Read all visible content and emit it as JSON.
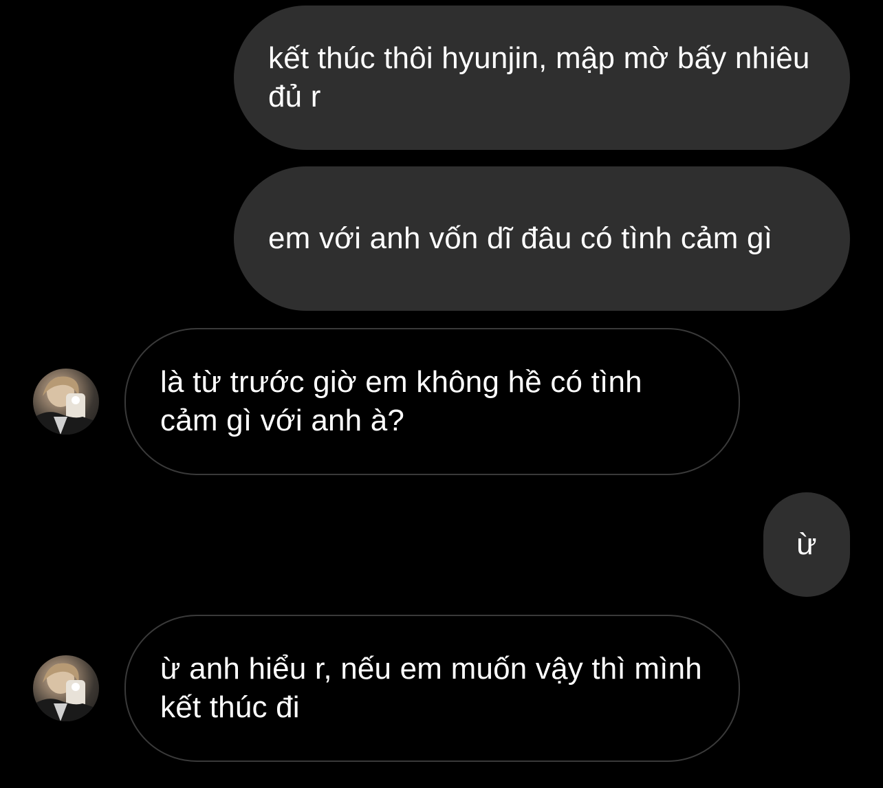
{
  "conversation": {
    "messages": [
      {
        "direction": "sent",
        "text": "kết thúc thôi hyunjin, mập mờ bấy nhiêu đủ r"
      },
      {
        "direction": "sent",
        "text": "em với anh vốn dĩ đâu có tình cảm gì"
      },
      {
        "direction": "received",
        "text": "là từ trước giờ em không hề có tình cảm gì với anh à?"
      },
      {
        "direction": "sent",
        "text": "ừ"
      },
      {
        "direction": "received",
        "text": "ừ anh hiểu r, nếu em muốn vậy thì mình kết thúc đi"
      }
    ]
  },
  "colors": {
    "background": "#000000",
    "sent_bubble": "#2f2f2f",
    "received_bubble_border": "#3a3a3a",
    "text": "#ffffff"
  },
  "icons": {
    "avatar": "contact-avatar-photo"
  }
}
